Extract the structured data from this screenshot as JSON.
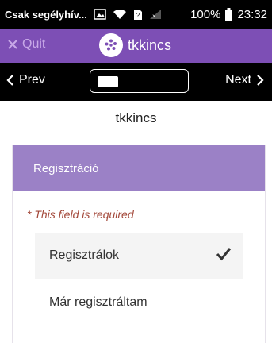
{
  "status_bar": {
    "carrier": "Csak segélyhív...",
    "battery": "100%",
    "time": "23:32"
  },
  "app_header": {
    "quit_label": "Quit",
    "title": "tkkincs"
  },
  "nav": {
    "prev_label": "Prev",
    "next_label": "Next"
  },
  "page": {
    "title": "tkkincs"
  },
  "form": {
    "section_title": "Regisztráció",
    "required_message": "* This field is required",
    "options": [
      {
        "label": "Regisztrálok",
        "selected": true
      },
      {
        "label": "Már regisztráltam",
        "selected": false
      }
    ]
  },
  "colors": {
    "header": "#7d4fb5",
    "card_header": "#9b81c6",
    "required": "#a3483a"
  }
}
